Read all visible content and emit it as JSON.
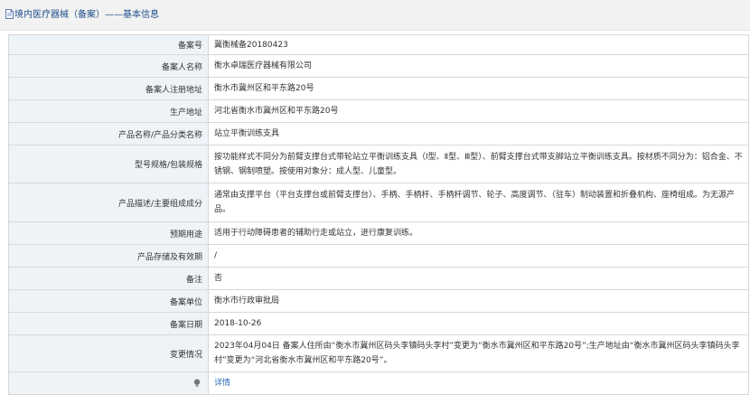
{
  "header": {
    "title": "境内医疗器械（备案）——基本信息",
    "icon": "document-icon"
  },
  "rows": [
    {
      "label": "备案号",
      "value": "冀衡械备20180423"
    },
    {
      "label": "备案人名称",
      "value": "衡水卓瑞医疗器械有限公司"
    },
    {
      "label": "备案人注册地址",
      "value": "衡水市冀州区和平东路20号"
    },
    {
      "label": "生产地址",
      "value": "河北省衡水市冀州区和平东路20号"
    },
    {
      "label": "产品名称/产品分类名称",
      "value": "站立平衡训练支具"
    },
    {
      "label": "型号规格/包装规格",
      "value": "按功能样式不同分为前臂支撑台式带轮站立平衡训练支具（Ⅰ型、Ⅱ型、Ⅲ型）、前臂支撑台式带支脚站立平衡训练支具。按材质不同分为：铝合金、不锈钢、钢制喷塑。按使用对象分：成人型、儿童型。"
    },
    {
      "label": "产品描述/主要组成成分",
      "value": "通常由支撑平台（平台支撑台或前臂支撑台）、手柄、手柄杆、手柄杆调节、轮子、高度调节、（驻车）制动装置和折叠机构、座椅组成。为无源产品。"
    },
    {
      "label": "预期用途",
      "value": "适用于行动障碍患者的辅助行走或站立，进行康复训练。"
    },
    {
      "label": "产品存储及有效期",
      "value": "/"
    },
    {
      "label": "备注",
      "value": "否"
    },
    {
      "label": "备案单位",
      "value": "衡水市行政审批局"
    },
    {
      "label": "备案日期",
      "value": "2018-10-26"
    },
    {
      "label": "变更情况",
      "value": "2023年04月04日 备案人住所由“衡水市冀州区码头李镇码头李村”变更为“衡水市冀州区和平东路20号”;生产地址由“衡水市冀州区码头李镇码头李村”变更为“河北省衡水市冀州区和平东路20号”。"
    }
  ],
  "footer_row": {
    "icon": "lightbulb-icon",
    "link_text": "详情"
  },
  "colors": {
    "header_bg": "#f2f2f2",
    "title_text": "#1f4e8c",
    "label_bg": "#eef3f8",
    "border": "#d8d8d8",
    "link": "#2f6eb5"
  }
}
